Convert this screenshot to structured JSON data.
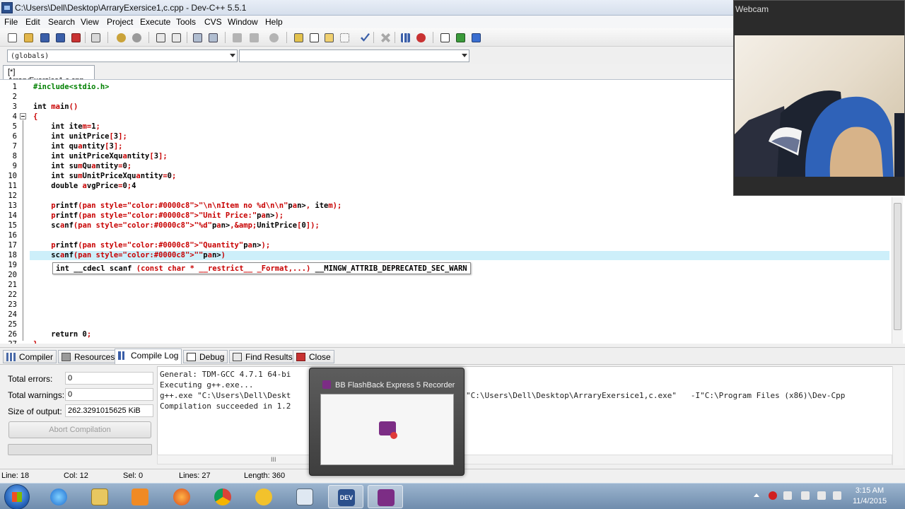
{
  "window": {
    "title": "C:\\Users\\Dell\\Desktop\\ArraryExersice1,c.cpp - Dev-C++ 5.5.1"
  },
  "menu": [
    "File",
    "Edit",
    "Search",
    "View",
    "Project",
    "Execute",
    "Tools",
    "CVS",
    "Window",
    "Help"
  ],
  "combos": {
    "left": "(globals)",
    "right": ""
  },
  "editor_tab": "[*] ArraryExersice1,c.cpp",
  "editor": {
    "lines": [
      {
        "n": "1",
        "code": "#include<stdio.h>"
      },
      {
        "n": "2",
        "code": ""
      },
      {
        "n": "3",
        "code": "int main()"
      },
      {
        "n": "4",
        "code": "{"
      },
      {
        "n": "5",
        "code": "    int item=1;"
      },
      {
        "n": "6",
        "code": "    int unitPrice[3];"
      },
      {
        "n": "7",
        "code": "    int quantity[3];"
      },
      {
        "n": "8",
        "code": "    int unitPriceXquantity[3];"
      },
      {
        "n": "9",
        "code": "    int sumQuantity=0;"
      },
      {
        "n": "10",
        "code": "    int sumUnitPriceXquantity=0;"
      },
      {
        "n": "11",
        "code": "    double avgPrice=0;4"
      },
      {
        "n": "12",
        "code": ""
      },
      {
        "n": "13",
        "code": "    printf(\"\\n\\nItem no %d\\n\\n\", item);"
      },
      {
        "n": "14",
        "code": "    printf(\"Unit Price:\");"
      },
      {
        "n": "15",
        "code": "    scanf(\"%d\",&UnitPrice[0]);"
      },
      {
        "n": "16",
        "code": ""
      },
      {
        "n": "17",
        "code": "    printf(\"Quantity\");"
      },
      {
        "n": "18",
        "code": "    scanf(\"\")"
      },
      {
        "n": "19",
        "code": ""
      },
      {
        "n": "20",
        "code": ""
      },
      {
        "n": "21",
        "code": ""
      },
      {
        "n": "22",
        "code": ""
      },
      {
        "n": "23",
        "code": ""
      },
      {
        "n": "24",
        "code": ""
      },
      {
        "n": "25",
        "code": ""
      },
      {
        "n": "26",
        "code": "    return 0;"
      },
      {
        "n": "27",
        "code": "}"
      }
    ],
    "tooltip": "int __cdecl scanf (const char * __restrict__ _Format,...) __MINGW_ATTRIB_DEPRECATED_SEC_WARN"
  },
  "bottom_tabs": [
    "Compiler",
    "Resources",
    "Compile Log",
    "Debug",
    "Find Results",
    "Close"
  ],
  "compile": {
    "errors_label": "Total errors:",
    "errors": "0",
    "warnings_label": "Total warnings:",
    "warnings": "0",
    "size_label": "Size of output:",
    "size": "262.3291015625 KiB",
    "abort": "Abort Compilation",
    "log": [
      "General: TDM-GCC 4.7.1 64-bi",
      "Executing g++.exe...",
      "g++.exe \"C:\\Users\\Dell\\Deskt",
      "Compilation succeeded in 1.2"
    ],
    "log_right": "\"C:\\Users\\Dell\\Desktop\\ArraryExersice1,c.exe\"   -I\"C:\\Program Files (x86)\\Dev-Cpp",
    "hscroll_grip": "III"
  },
  "status": {
    "line": "Line:  18",
    "col": "Col:  12",
    "sel": "Sel:   0",
    "lines": "Lines:  27",
    "length": "Length:  360"
  },
  "webcam": {
    "title": "Webcam"
  },
  "flashback": {
    "title": "BB FlashBack Express 5 Recorder"
  },
  "taskbar": {
    "time": "3:15 AM",
    "date": "11/4/2015",
    "dev_label": "DEV"
  },
  "colors": {
    "keyword_red": "#c80000",
    "string_blue": "#0000c8",
    "comment_green": "#008000",
    "current_line": "#cdeffa"
  }
}
